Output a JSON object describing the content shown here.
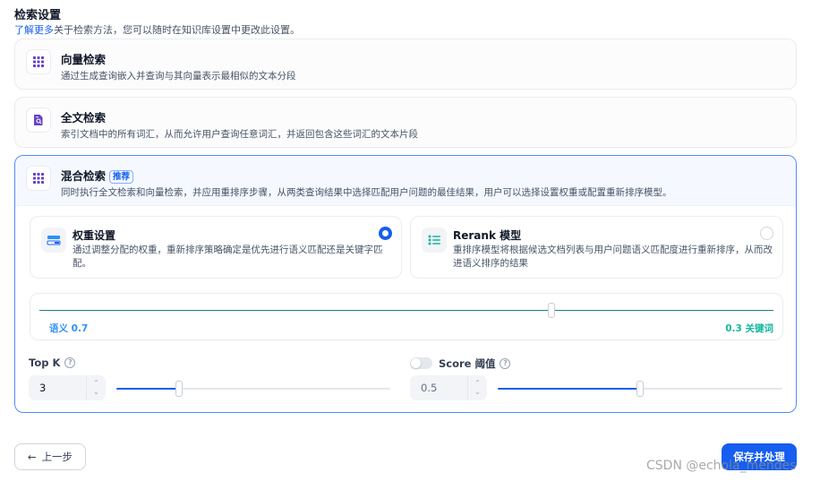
{
  "section": {
    "title": "检索设置",
    "learn_more": "了解更多",
    "subtitle": "关于检索方法，您可以随时在知识库设置中更改此设置。"
  },
  "methods": [
    {
      "title": "向量检索",
      "desc": "通过生成查询嵌入并查询与其向量表示最相似的文本分段",
      "icon": "grid-icon"
    },
    {
      "title": "全文检索",
      "desc": "索引文档中的所有词汇，从而允许用户查询任意词汇，并返回包含这些词汇的文本片段",
      "icon": "document-search-icon"
    },
    {
      "title": "混合检索",
      "badge": "推荐",
      "desc": "同时执行全文检索和向量检索，并应用重排序步骤，从两类查询结果中选择匹配用户问题的最佳结果，用户可以选择设置权重或配置重新排序模型。",
      "icon": "grid-icon"
    }
  ],
  "options": {
    "weight": {
      "title": "权重设置",
      "desc": "通过调整分配的权重，重新排序策略确定是优先进行语义匹配还是关键字匹配。",
      "selected": true
    },
    "rerank": {
      "title": "Rerank 模型",
      "desc": "重排序模型将根据候选文档列表与用户问题语义匹配度进行重新排序，从而改进语义排序的结果",
      "selected": false
    }
  },
  "weights": {
    "semantic_label": "语义 0.7",
    "keyword_label": "0.3 关键词",
    "semantic": 0.7,
    "keyword": 0.3
  },
  "top_k": {
    "label": "Top K",
    "value": "3",
    "slider_fraction": 0.23
  },
  "score": {
    "label": "Score 阈值",
    "value": "0.5",
    "enabled": false,
    "slider_fraction": 0.5
  },
  "buttons": {
    "back": "上一步",
    "save": "保存并处理"
  },
  "watermark": "CSDN @echola_mendes",
  "colors": {
    "accent": "#155eef",
    "semantic": "#2e90fa",
    "keyword": "#15b79e"
  }
}
